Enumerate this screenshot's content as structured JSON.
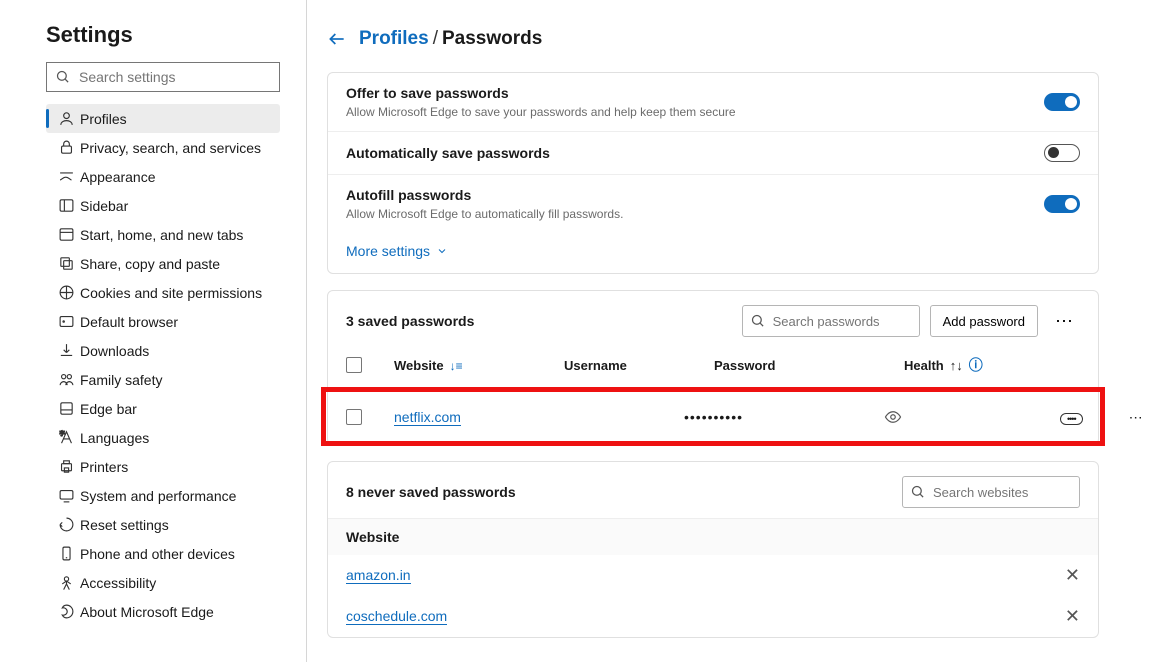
{
  "sidebar": {
    "title": "Settings",
    "search_placeholder": "Search settings",
    "items": [
      {
        "label": "Profiles",
        "active": true
      },
      {
        "label": "Privacy, search, and services"
      },
      {
        "label": "Appearance"
      },
      {
        "label": "Sidebar"
      },
      {
        "label": "Start, home, and new tabs"
      },
      {
        "label": "Share, copy and paste"
      },
      {
        "label": "Cookies and site permissions"
      },
      {
        "label": "Default browser"
      },
      {
        "label": "Downloads"
      },
      {
        "label": "Family safety"
      },
      {
        "label": "Edge bar"
      },
      {
        "label": "Languages"
      },
      {
        "label": "Printers"
      },
      {
        "label": "System and performance"
      },
      {
        "label": "Reset settings"
      },
      {
        "label": "Phone and other devices"
      },
      {
        "label": "Accessibility"
      },
      {
        "label": "About Microsoft Edge"
      }
    ]
  },
  "breadcrumb": {
    "parent": "Profiles",
    "current": "Passwords"
  },
  "settings": {
    "offer": {
      "title": "Offer to save passwords",
      "desc": "Allow Microsoft Edge to save your passwords and help keep them secure"
    },
    "auto": {
      "title": "Automatically save passwords"
    },
    "autofill": {
      "title": "Autofill passwords",
      "desc": "Allow Microsoft Edge to automatically fill passwords."
    },
    "more": "More settings"
  },
  "passwords": {
    "count_label": "3 saved passwords",
    "search_placeholder": "Search passwords",
    "add_label": "Add password",
    "cols": {
      "website": "Website",
      "username": "Username",
      "password": "Password",
      "health": "Health"
    },
    "rows": [
      {
        "site": "netflix.com",
        "password_mask": "••••••••••",
        "health": "••••"
      }
    ]
  },
  "never_saved": {
    "count_label": "8 never saved passwords",
    "search_placeholder": "Search websites",
    "col": "Website",
    "rows": [
      {
        "site": "amazon.in"
      },
      {
        "site": "coschedule.com"
      }
    ]
  }
}
